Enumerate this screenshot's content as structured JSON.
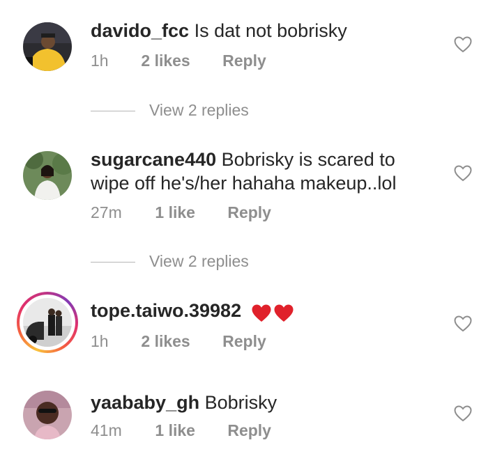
{
  "comments": [
    {
      "username": "davido_fcc",
      "text": "Is dat not bobrisky",
      "time": "1h",
      "likes": "2 likes",
      "reply": "Reply",
      "view_replies": "View 2 replies"
    },
    {
      "username": "sugarcane440",
      "text": "Bobrisky is scared to",
      "text_line2": "wipe off he's/her hahaha makeup..lol",
      "time": "27m",
      "likes": "1 like",
      "reply": "Reply",
      "view_replies": "View 2 replies"
    },
    {
      "username": "tope.taiwo.39982",
      "emoji": "heart-emoji x2",
      "time": "1h",
      "likes": "2 likes",
      "reply": "Reply"
    },
    {
      "username": "yaababy_gh",
      "text": "Bobrisky",
      "time": "41m",
      "likes": "1 like",
      "reply": "Reply"
    }
  ],
  "icons": {
    "like": "heart-outline-icon",
    "emoji": "red-heart-emoji"
  },
  "colors": {
    "text": "#262626",
    "meta": "#8e8e8e",
    "emoji_heart": "#e0212b",
    "story_ring": [
      "#f9c23c",
      "#e1306c",
      "#833ab4"
    ]
  }
}
